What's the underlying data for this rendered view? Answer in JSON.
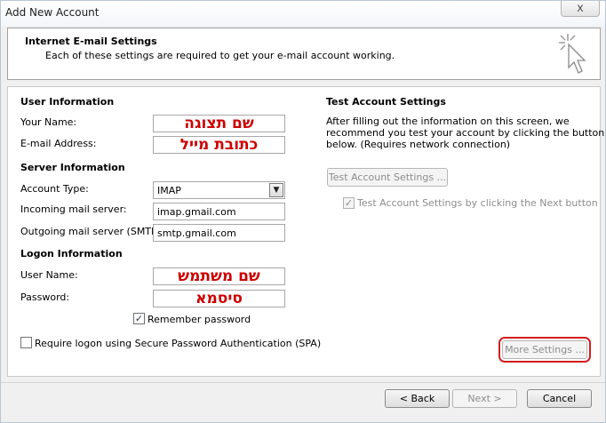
{
  "window": {
    "title": "Add New Account",
    "close_symbol": "x"
  },
  "header": {
    "title": "Internet E-mail Settings",
    "subtitle": "Each of these settings are required to get your e-mail account working."
  },
  "user_info": {
    "heading": "User Information",
    "name_label": "Your Name:",
    "name_value": "שם תצוגה",
    "email_label": "E-mail Address:",
    "email_value": "כתובת מייל"
  },
  "server_info": {
    "heading": "Server Information",
    "account_type_label": "Account Type:",
    "account_type_value": "IMAP",
    "incoming_label": "Incoming mail server:",
    "incoming_value": "imap.gmail.com",
    "outgoing_label": "Outgoing mail server (SMTP):",
    "outgoing_value": "smtp.gmail.com"
  },
  "logon_info": {
    "heading": "Logon Information",
    "username_label": "User Name:",
    "username_value": "שם משתמש",
    "password_label": "Password:",
    "password_value": "סיסמא",
    "remember_label": "Remember password",
    "remember_checked": true,
    "spa_label": "Require logon using Secure Password Authentication (SPA)",
    "spa_checked": false
  },
  "test_settings": {
    "heading": "Test Account Settings",
    "description_1": "After filling out the information on this screen, we",
    "description_2": "recommend you test your account by clicking the button",
    "description_3": "below. (Requires network connection)",
    "test_button": "Test Account Settings ...",
    "auto_test_label": "Test Account Settings by clicking the Next button",
    "auto_test_checked": true
  },
  "more_settings_button": "More Settings ...",
  "footer": {
    "back": "< Back",
    "next": "Next >",
    "cancel": "Cancel"
  },
  "colors": {
    "highlight_red": "#d21e1e",
    "hebrew_text_red": "#cc0000",
    "disabled_text": "#8d8d8d"
  }
}
